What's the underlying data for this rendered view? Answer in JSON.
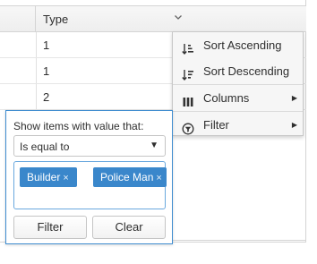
{
  "grid": {
    "columns": [
      {
        "title": ""
      },
      {
        "title": "Type"
      }
    ],
    "rows": [
      {
        "type": "1"
      },
      {
        "type": "1"
      },
      {
        "type": "2"
      }
    ]
  },
  "column_menu": {
    "items": [
      {
        "label": "Sort Ascending",
        "icon": "sort-ascending-icon"
      },
      {
        "label": "Sort Descending",
        "icon": "sort-descending-icon"
      },
      {
        "label": "Columns",
        "icon": "columns-icon",
        "submenu": true
      },
      {
        "label": "Filter",
        "icon": "filter-icon",
        "submenu": true
      }
    ]
  },
  "filter": {
    "help_text": "Show items with value that:",
    "operator": "Is equal to",
    "values": [
      "Builder",
      "Police Man"
    ],
    "filter_label": "Filter",
    "clear_label": "Clear"
  },
  "colors": {
    "accent": "#3a87cb",
    "panel_border": "#3f8dd0"
  }
}
